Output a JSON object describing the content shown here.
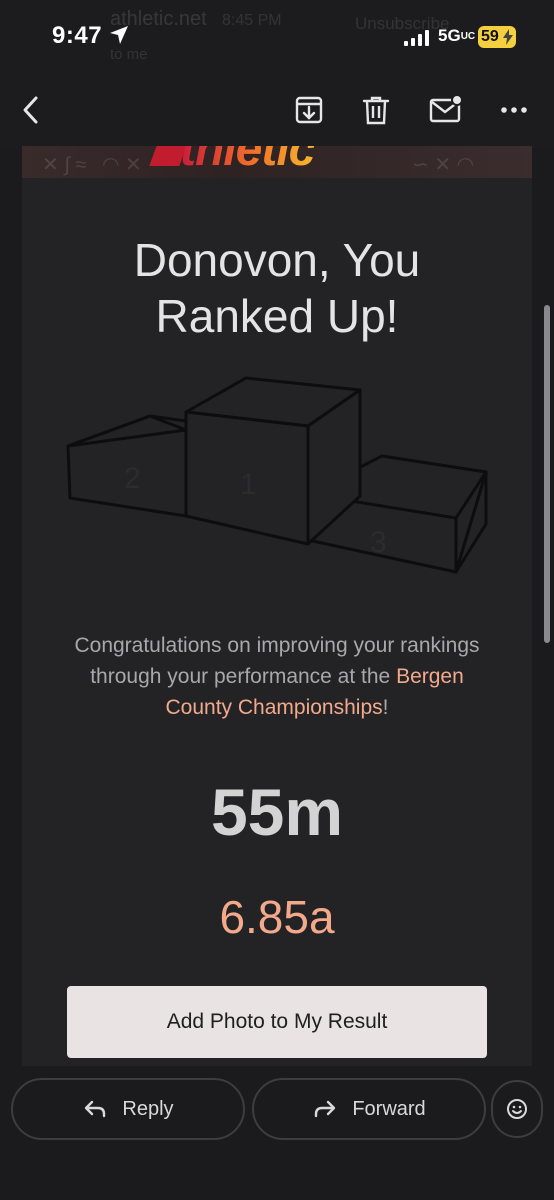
{
  "status_bar": {
    "time": "9:47",
    "network": "5G",
    "network_suffix": "UC",
    "battery": "59"
  },
  "background_header": {
    "sender": "athletic.net",
    "time": "8:45 PM",
    "unsubscribe": "Unsubscribe",
    "to": "to me"
  },
  "toolbar": {
    "back_icon": "chevron-left-icon",
    "archive_icon": "archive-icon",
    "delete_icon": "trash-icon",
    "unread_icon": "mark-unread-icon",
    "more_icon": "more-horizontal-icon"
  },
  "email": {
    "brand": "thletic",
    "headline_line1": "Donovon, You",
    "headline_line2": "Ranked Up!",
    "podium_labels": [
      "2",
      "1",
      "3"
    ],
    "congrats_before": "Congratulations on improving your rankings through your performance at the ",
    "meet_link": "Bergen County Championships",
    "congrats_after": "!",
    "event": "55m",
    "result": "6.85a",
    "cta_label": "Add Photo to My Result"
  },
  "action_bar": {
    "reply_label": "Reply",
    "forward_label": "Forward",
    "emoji_icon": "smiley-icon"
  },
  "colors": {
    "accent": "#f4a98b",
    "card": "#232326",
    "background": "#1b1b1d",
    "button": "#e9e3e3"
  }
}
